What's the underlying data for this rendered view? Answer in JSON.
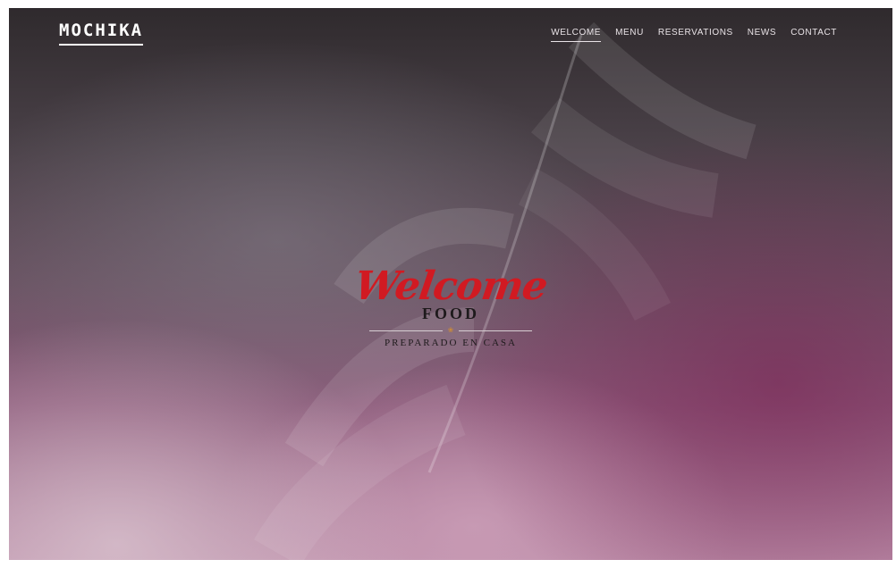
{
  "brand": {
    "name": "MOCHIKA"
  },
  "nav": {
    "items": [
      {
        "label": "WELCOME",
        "active": true
      },
      {
        "label": "MENU"
      },
      {
        "label": "RESERVATIONS"
      },
      {
        "label": "NEWS"
      },
      {
        "label": "CONTACT"
      }
    ]
  },
  "hero": {
    "script_text": "Welcome",
    "title": "FOOD",
    "ornament": "❀",
    "subtitle": "PREPARADO EN CASA"
  },
  "colors": {
    "accent_red": "#d11a22",
    "ornament_gold": "#c98a3a",
    "text_dark": "#1e1a1c"
  }
}
